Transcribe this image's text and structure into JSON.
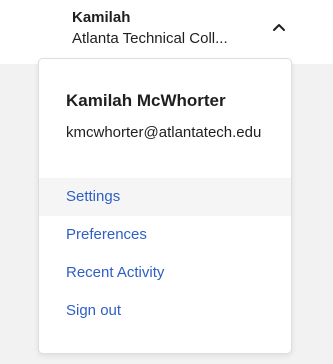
{
  "account_trigger": {
    "name": "Kamilah",
    "organization": "Atlanta Technical Coll..."
  },
  "dropdown": {
    "full_name": "Kamilah McWhorter",
    "email": "kmcwhorter@atlantatech.edu",
    "menu_items": [
      {
        "label": "Settings"
      },
      {
        "label": "Preferences"
      },
      {
        "label": "Recent Activity"
      },
      {
        "label": "Sign out"
      }
    ]
  },
  "colors": {
    "link": "#2f5fc4",
    "hover_background": "#f5f5f5",
    "backdrop": "#f2f2f2"
  }
}
